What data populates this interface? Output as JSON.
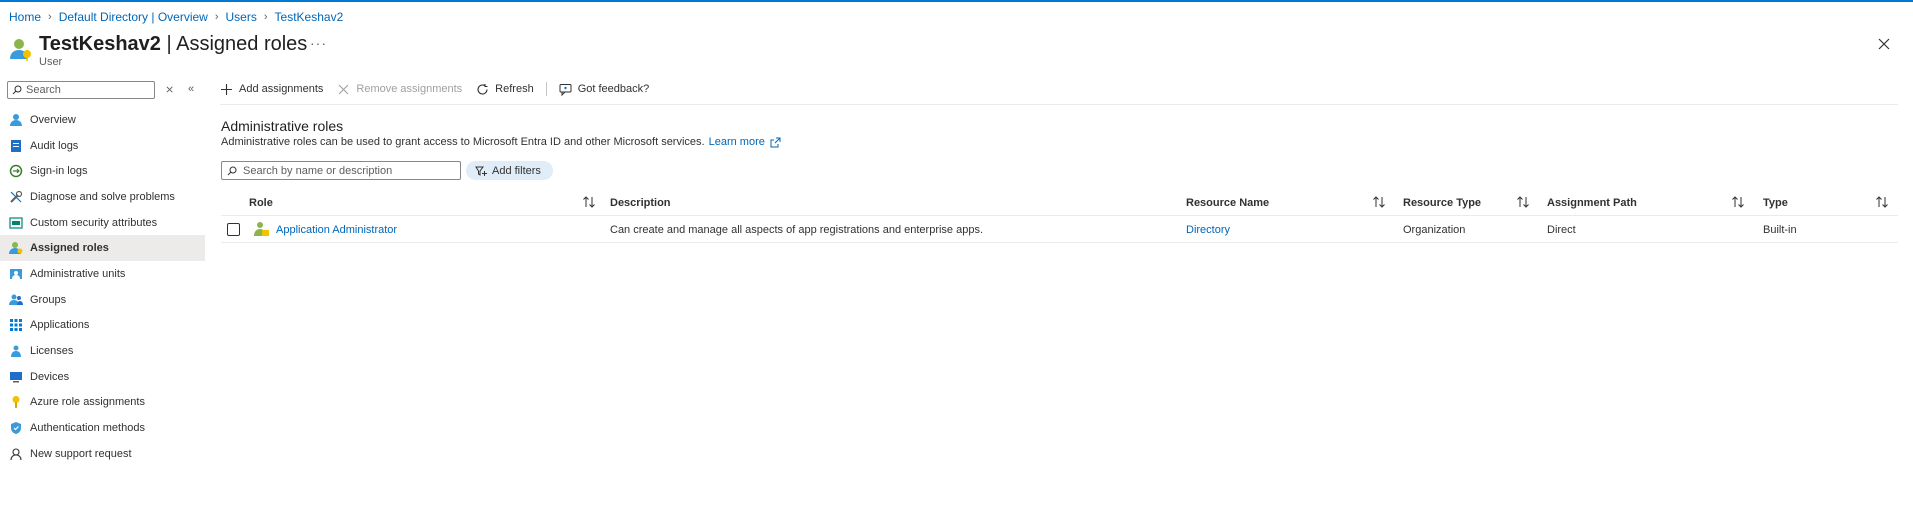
{
  "breadcrumb": [
    {
      "label": "Home"
    },
    {
      "label": "Default Directory | Overview"
    },
    {
      "label": "Users"
    },
    {
      "label": "TestKeshav2"
    }
  ],
  "header": {
    "title_bold": "TestKeshav2",
    "title_rest": " | Assigned roles",
    "subtitle": "User",
    "more_label": "···"
  },
  "sidebar": {
    "search_placeholder": "Search",
    "items": [
      {
        "label": "Overview",
        "icon": "user-icon"
      },
      {
        "label": "Audit logs",
        "icon": "audit-log-icon"
      },
      {
        "label": "Sign-in logs",
        "icon": "sign-in-icon"
      },
      {
        "label": "Diagnose and solve problems",
        "icon": "wrench-icon"
      },
      {
        "label": "Custom security attributes",
        "icon": "attributes-icon"
      },
      {
        "label": "Assigned roles",
        "icon": "assigned-roles-icon",
        "active": true
      },
      {
        "label": "Administrative units",
        "icon": "admin-units-icon"
      },
      {
        "label": "Groups",
        "icon": "groups-icon"
      },
      {
        "label": "Applications",
        "icon": "apps-grid-icon"
      },
      {
        "label": "Licenses",
        "icon": "license-icon"
      },
      {
        "label": "Devices",
        "icon": "device-icon"
      },
      {
        "label": "Azure role assignments",
        "icon": "key-icon"
      },
      {
        "label": "Authentication methods",
        "icon": "shield-icon"
      },
      {
        "label": "New support request",
        "icon": "support-icon"
      }
    ]
  },
  "toolbar": {
    "add": "Add assignments",
    "remove": "Remove assignments",
    "refresh": "Refresh",
    "feedback": "Got feedback?"
  },
  "section": {
    "title": "Administrative roles",
    "description": "Administrative roles can be used to grant access to Microsoft Entra ID and other Microsoft services.",
    "learn_more": "Learn more"
  },
  "filters": {
    "search_placeholder": "Search by name or description",
    "add_filters": "Add filters"
  },
  "table": {
    "columns": [
      "Role",
      "Description",
      "Resource Name",
      "Resource Type",
      "Assignment Path",
      "Type"
    ],
    "rows": [
      {
        "role": "Application Administrator",
        "description": "Can create and manage all aspects of app registrations and enterprise apps.",
        "resource_name": "Directory",
        "resource_type": "Organization",
        "assignment_path": "Direct",
        "type": "Built-in"
      }
    ]
  },
  "colors": {
    "accent": "#0078d4",
    "link": "#0066b8",
    "active_bg": "#edebe9"
  }
}
